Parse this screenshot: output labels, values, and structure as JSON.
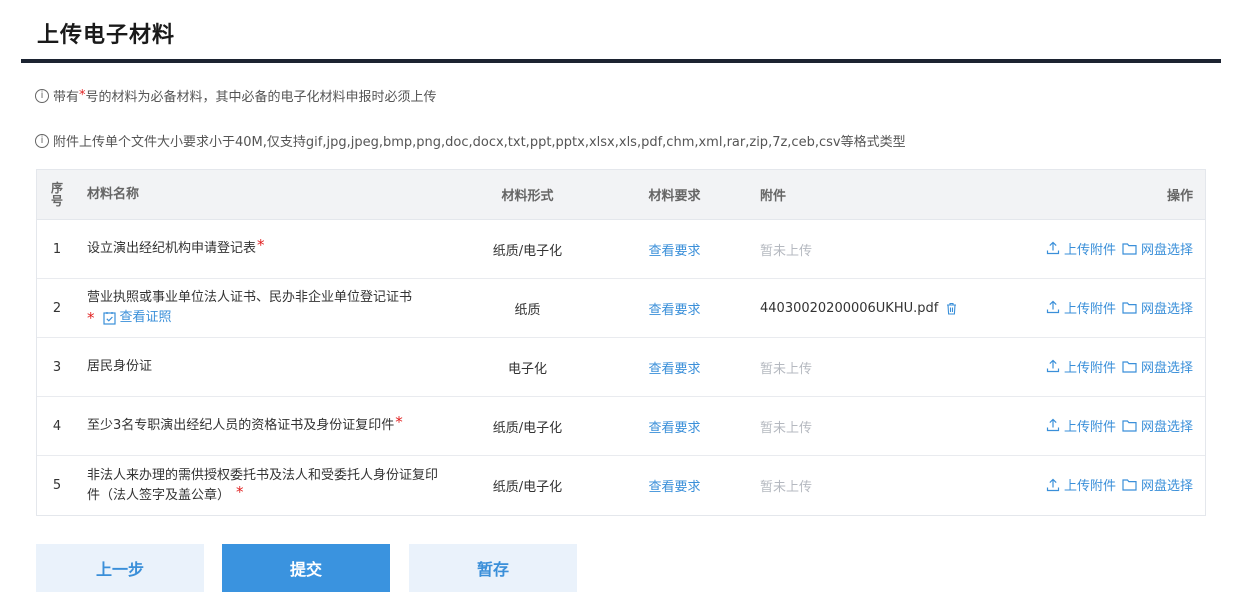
{
  "page": {
    "title": "上传电子材料"
  },
  "notices": {
    "line1_prefix": "带有",
    "line1_star": "*",
    "line1_suffix": "号的材料为必备材料，其中必备的电子化材料申报时必须上传",
    "line2": "附件上传单个文件大小要求小于40M,仅支持gif,jpg,jpeg,bmp,png,doc,docx,txt,ppt,pptx,xlsx,xls,pdf,chm,xml,rar,zip,7z,ceb,csv等格式类型"
  },
  "table": {
    "headers": {
      "index": "序号",
      "name": "材料名称",
      "form": "材料形式",
      "requirement": "材料要求",
      "attachment": "附件",
      "action": "操作"
    },
    "rows": [
      {
        "index": "1",
        "name": "设立演出经纪机构申请登记表",
        "required": "*",
        "form": "纸质/电子化",
        "requirement": "查看要求",
        "attachment": "暂未上传"
      },
      {
        "index": "2",
        "name": "营业执照或事业单位法人证书、民办非企业单位登记证书",
        "required": "*",
        "cert_link": "查看证照",
        "form": "纸质",
        "requirement": "查看要求",
        "attachment": "44030020200006UKHU.pdf"
      },
      {
        "index": "3",
        "name": "居民身份证",
        "form": "电子化",
        "requirement": "查看要求",
        "attachment": "暂未上传"
      },
      {
        "index": "4",
        "name": "至少3名专职演出经纪人员的资格证书及身份证复印件",
        "required": "*",
        "form": "纸质/电子化",
        "requirement": "查看要求",
        "attachment": "暂未上传"
      },
      {
        "index": "5",
        "name": "非法人来办理的需供授权委托书及法人和受委托人身份证复印件（法人签字及盖公章）",
        "required": "*",
        "form": "纸质/电子化",
        "requirement": "查看要求",
        "attachment": "暂未上传"
      }
    ],
    "actions": {
      "upload": "上传附件",
      "netdisk": "网盘选择"
    }
  },
  "buttons": {
    "prev": "上一步",
    "submit": "提交",
    "save": "暂存"
  },
  "colors": {
    "accent": "#3a8fd9",
    "primary_button": "#3a93df",
    "required": "#e02020",
    "title_rule": "#1c2331"
  },
  "icons": {
    "info": "info-circle-icon",
    "upload": "upload-icon",
    "folder": "folder-icon",
    "certificate": "certificate-check-icon",
    "delete": "trash-icon"
  }
}
